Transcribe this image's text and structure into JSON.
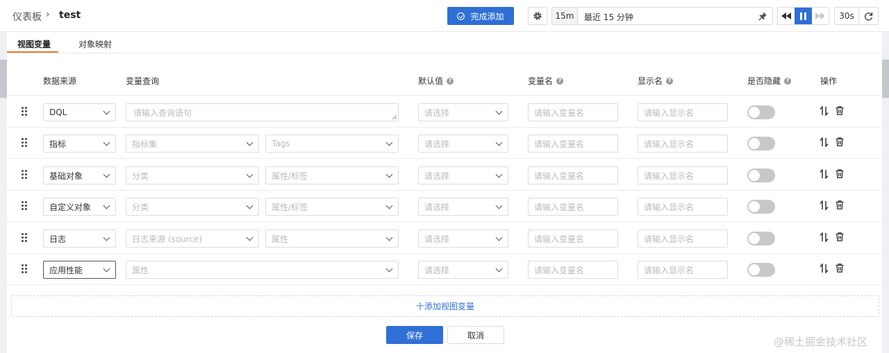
{
  "breadcrumb": {
    "root": "仪表板",
    "separator": "›",
    "current": "test"
  },
  "toolbar": {
    "done_label": "完成添加",
    "time_short": "15m",
    "time_label": "最近 15 分钟",
    "refresh_interval": "30s",
    "accent": "#2f6fd6"
  },
  "tabs": [
    {
      "label": "视图变量",
      "active": true
    },
    {
      "label": "对象映射",
      "active": false
    }
  ],
  "columns": {
    "source": "数据来源",
    "query": "变量查询",
    "default": "默认值",
    "varname": "变量名",
    "display": "显示名",
    "hidden": "是否隐藏",
    "ops": "操作"
  },
  "placeholders": {
    "default": "请选择",
    "varname": "请输入变量名",
    "display": "请输入显示名"
  },
  "rows": [
    {
      "source": "DQL",
      "query_main": "请输入查询语句"
    },
    {
      "source": "指标",
      "query_main": "指标集",
      "query_sub": "Tags"
    },
    {
      "source": "基础对象",
      "query_main": "分类",
      "query_sub": "属性/标签"
    },
    {
      "source": "自定义对象",
      "query_main": "分类",
      "query_sub": "属性/标签"
    },
    {
      "source": "日志",
      "query_main": "日志来源 (source)",
      "query_sub": "属性"
    },
    {
      "source": "应用性能",
      "query_main": "属性"
    }
  ],
  "add_label": "十添加视图变量",
  "save_label": "保存",
  "cancel_label": "取消",
  "watermark": "@稀土掘金技术社区"
}
